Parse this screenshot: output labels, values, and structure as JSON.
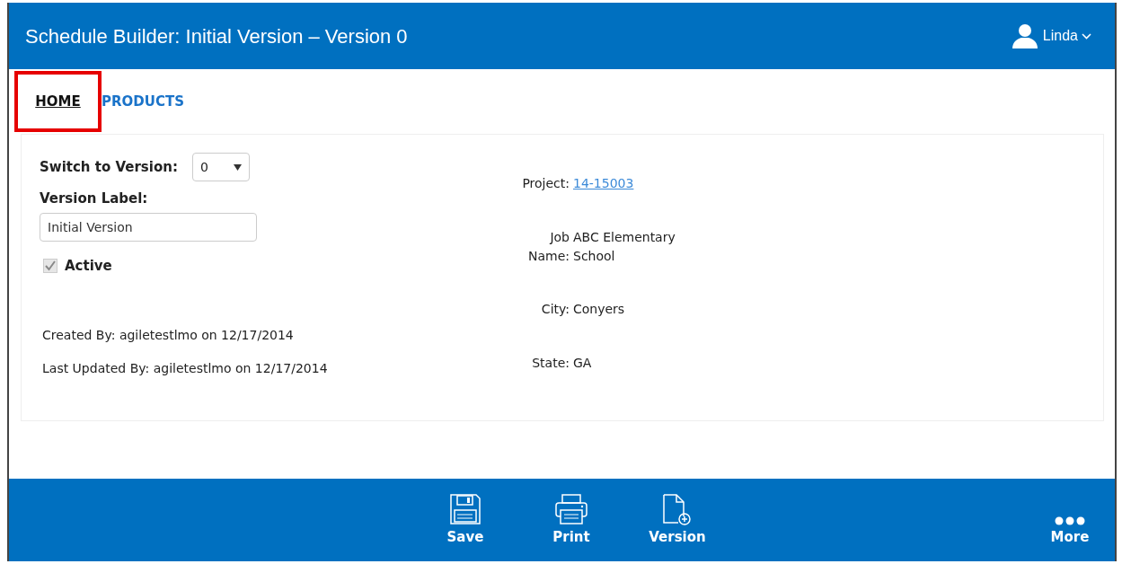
{
  "window": {
    "title": "Schedule Builder: Initial Version – Version 0",
    "user": "Linda"
  },
  "tabs": [
    {
      "label": "HOME",
      "selected": true,
      "highlighted": true
    },
    {
      "label": "PRODUCTS",
      "selected": false,
      "highlighted": false
    }
  ],
  "form": {
    "switch_label": "Switch to Version:",
    "version_value": "0",
    "label_label": "Version Label:",
    "label_value": "Initial Version",
    "active": {
      "label": "Active",
      "checked": true,
      "disabled": true
    }
  },
  "details": [
    {
      "label": "Project:",
      "value": "14-15003",
      "kind": "link"
    },
    {
      "label": "Job Name:",
      "value": "ABC Elementary School",
      "kind": "text"
    },
    {
      "label": "City:",
      "value": "Conyers",
      "kind": "text"
    },
    {
      "label": "State:",
      "value": "GA",
      "kind": "text"
    }
  ],
  "audit": [
    "Created By: agiletestlmo on 12/17/2014",
    "Last Updated By: agiletestlmo on 12/17/2014"
  ],
  "toolbar": [
    {
      "label": "Save",
      "kind": "save"
    },
    {
      "label": "Print",
      "kind": "print"
    },
    {
      "label": "Version",
      "kind": "version"
    },
    {
      "label": "More",
      "kind": "more"
    }
  ]
}
